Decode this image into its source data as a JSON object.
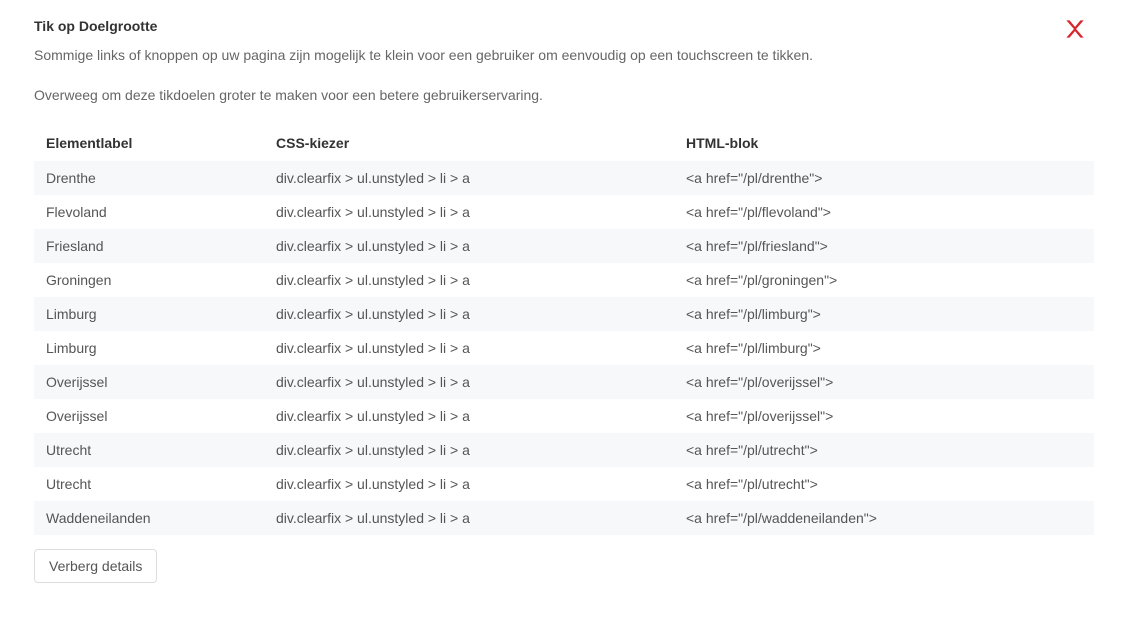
{
  "section": {
    "title": "Tik op Doelgrootte",
    "desc1": "Sommige links of knoppen op uw pagina zijn mogelijk te klein voor een gebruiker om eenvoudig op een touchscreen te tikken.",
    "desc2": "Overweeg om deze tikdoelen groter te maken voor een betere gebruikerservaring.",
    "close_icon": "close"
  },
  "table": {
    "headers": {
      "label": "Elementlabel",
      "css": "CSS-kiezer",
      "html": "HTML-blok"
    },
    "rows": [
      {
        "label": "Drenthe",
        "css": "div.clearfix > ul.unstyled > li > a",
        "html": "<a href=\"/pl/drenthe\">"
      },
      {
        "label": "Flevoland",
        "css": "div.clearfix > ul.unstyled > li > a",
        "html": "<a href=\"/pl/flevoland\">"
      },
      {
        "label": "Friesland",
        "css": "div.clearfix > ul.unstyled > li > a",
        "html": "<a href=\"/pl/friesland\">"
      },
      {
        "label": "Groningen",
        "css": "div.clearfix > ul.unstyled > li > a",
        "html": "<a href=\"/pl/groningen\">"
      },
      {
        "label": "Limburg",
        "css": "div.clearfix > ul.unstyled > li > a",
        "html": "<a href=\"/pl/limburg\">"
      },
      {
        "label": "Limburg",
        "css": "div.clearfix > ul.unstyled > li > a",
        "html": "<a href=\"/pl/limburg\">"
      },
      {
        "label": "Overijssel",
        "css": "div.clearfix > ul.unstyled > li > a",
        "html": "<a href=\"/pl/overijssel\">"
      },
      {
        "label": "Overijssel",
        "css": "div.clearfix > ul.unstyled > li > a",
        "html": "<a href=\"/pl/overijssel\">"
      },
      {
        "label": "Utrecht",
        "css": "div.clearfix > ul.unstyled > li > a",
        "html": "<a href=\"/pl/utrecht\">"
      },
      {
        "label": "Utrecht",
        "css": "div.clearfix > ul.unstyled > li > a",
        "html": "<a href=\"/pl/utrecht\">"
      },
      {
        "label": "Waddeneilanden",
        "css": "div.clearfix > ul.unstyled > li > a",
        "html": "<a href=\"/pl/waddeneilanden\">"
      }
    ]
  },
  "actions": {
    "hide_details": "Verberg details"
  }
}
